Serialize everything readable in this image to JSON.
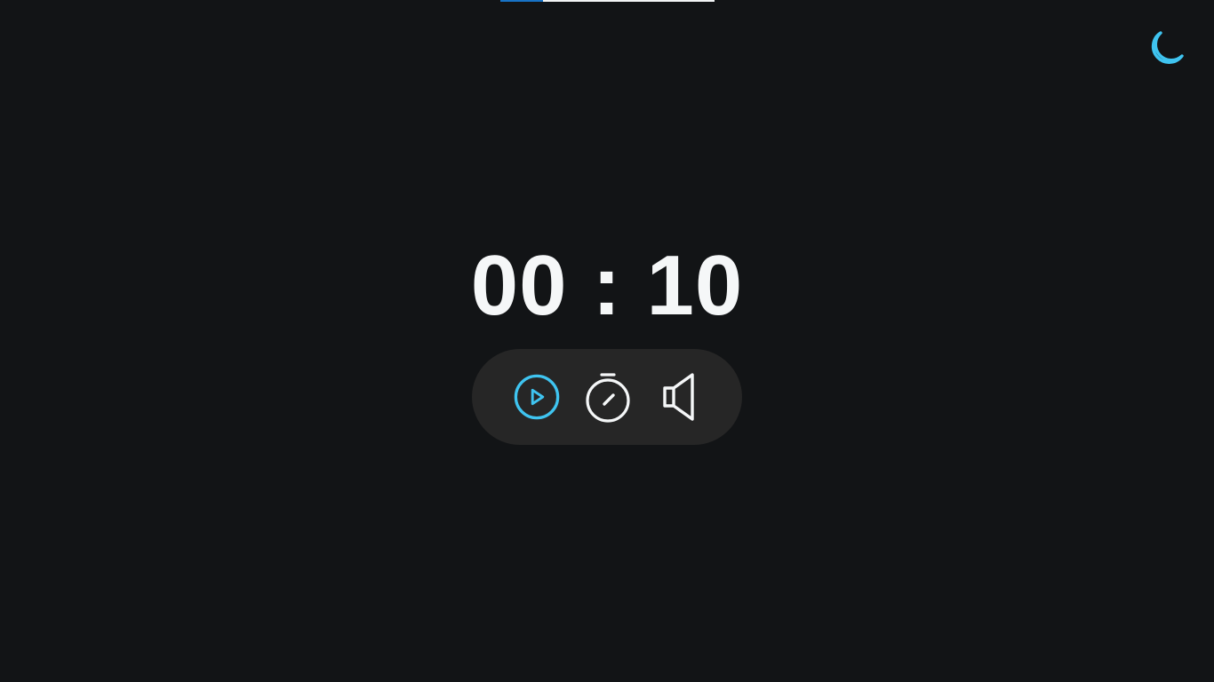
{
  "timer": {
    "minutes": "00",
    "separator": ":",
    "seconds": "10"
  },
  "progress": {
    "fraction": 0.2
  },
  "icons": {
    "theme_toggle": "moon-icon",
    "play": "play-circle-icon",
    "timer_settings": "stopwatch-icon",
    "sound": "speaker-icon"
  },
  "colors": {
    "background": "#121416",
    "accent": "#3fc4f0",
    "text": "#f5f7f8",
    "controls_bg": "#262626",
    "progress_fill": "#1873c6",
    "progress_track": "#f2f4f5"
  }
}
